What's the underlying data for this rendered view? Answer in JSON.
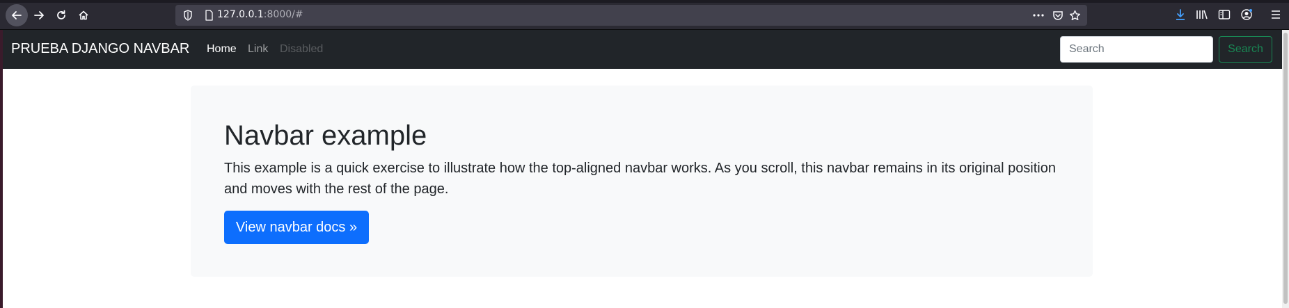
{
  "browser": {
    "url_host": "127.0.0.1",
    "url_rest": ":8000/#",
    "icons": {
      "back": "back-arrow-icon",
      "forward": "forward-arrow-icon",
      "reload": "reload-icon",
      "home": "home-icon",
      "more": "more-icon",
      "pocket": "pocket-icon",
      "bookmark": "star-icon",
      "downloads": "download-icon",
      "library": "library-icon",
      "sidebar": "sidebar-icon",
      "account": "account-icon",
      "menu": "menu-icon"
    }
  },
  "navbar": {
    "brand": "PRUEBA DJANGO NAVBAR",
    "links": [
      {
        "label": "Home",
        "active": true
      },
      {
        "label": "Link",
        "active": false
      },
      {
        "label": "Disabled",
        "disabled": true
      }
    ],
    "search": {
      "placeholder": "Search",
      "button_label": "Search"
    }
  },
  "jumbotron": {
    "title": "Navbar example",
    "lead": "This example is a quick exercise to illustrate how the top-aligned navbar works. As you scroll, this navbar remains in its original position and moves with the rest of the page.",
    "button_label": "View navbar docs »"
  },
  "colors": {
    "navbar_bg": "#212529",
    "primary": "#0d6efd",
    "success": "#198754",
    "jumbo_bg": "#f8f9fa"
  }
}
